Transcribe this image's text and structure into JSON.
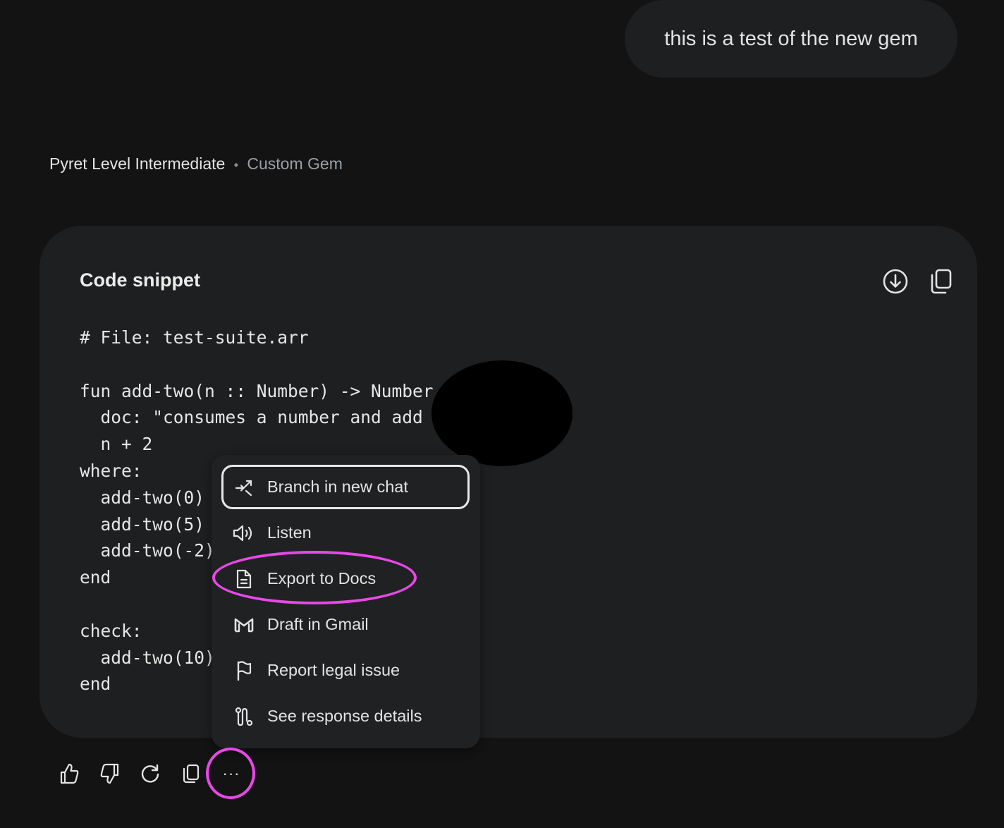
{
  "user_message": "this is a test of the new gem",
  "gem": {
    "name": "Pyret Level Intermediate",
    "separator": "•",
    "type": "Custom Gem"
  },
  "code_block": {
    "title": "Code snippet",
    "download_icon": "download-circle-icon",
    "copy_icon": "copy-icon",
    "lines": [
      "# File: test-suite.arr",
      "",
      "fun add-two(n :: Number) -> Number",
      "  doc: \"consumes a number and add",
      "  n + 2",
      "where:",
      "  add-two(0)",
      "  add-two(5)",
      "  add-two(-2)",
      "end",
      "",
      "check:",
      "  add-two(10)",
      "end"
    ]
  },
  "menu": {
    "items": [
      {
        "label": "Branch in new chat",
        "icon": "branch-icon"
      },
      {
        "label": "Listen",
        "icon": "speaker-icon"
      },
      {
        "label": "Export to Docs",
        "icon": "document-icon"
      },
      {
        "label": "Draft in Gmail",
        "icon": "gmail-icon"
      },
      {
        "label": "Report legal issue",
        "icon": "flag-icon"
      },
      {
        "label": "See response details",
        "icon": "route-icon"
      }
    ]
  },
  "actions": {
    "like_icon": "thumbs-up-icon",
    "dislike_icon": "thumbs-down-icon",
    "redo_icon": "refresh-icon",
    "copy_icon": "copy-icon",
    "more_label": "···"
  },
  "colors": {
    "background": "#131314",
    "surface": "#1e1f20",
    "menu_surface": "#202122",
    "annotation": "#e848e8"
  }
}
